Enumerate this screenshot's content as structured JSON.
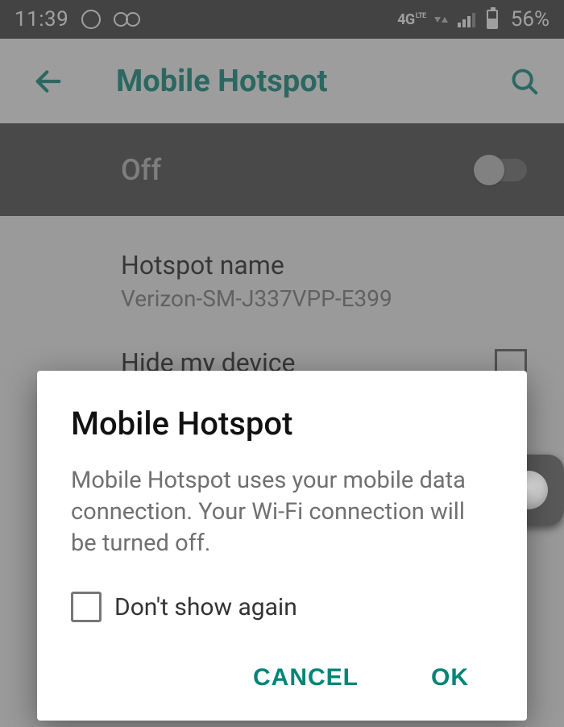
{
  "status": {
    "time": "11:39",
    "network_type": "4G",
    "network_sub": "LTE",
    "battery_pct": "56%"
  },
  "appbar": {
    "title": "Mobile Hotspot"
  },
  "toggle": {
    "state_label": "Off"
  },
  "settings": {
    "hotspot_name_label": "Hotspot name",
    "hotspot_name_value": "Verizon-SM-J337VPP-E399",
    "hide_device_label": "Hide my device"
  },
  "dialog": {
    "title": "Mobile Hotspot",
    "body": "Mobile Hotspot uses your mobile data connection. Your Wi-Fi connection will be turned off.",
    "checkbox_label": "Don't show again",
    "cancel": "CANCEL",
    "ok": "OK"
  }
}
